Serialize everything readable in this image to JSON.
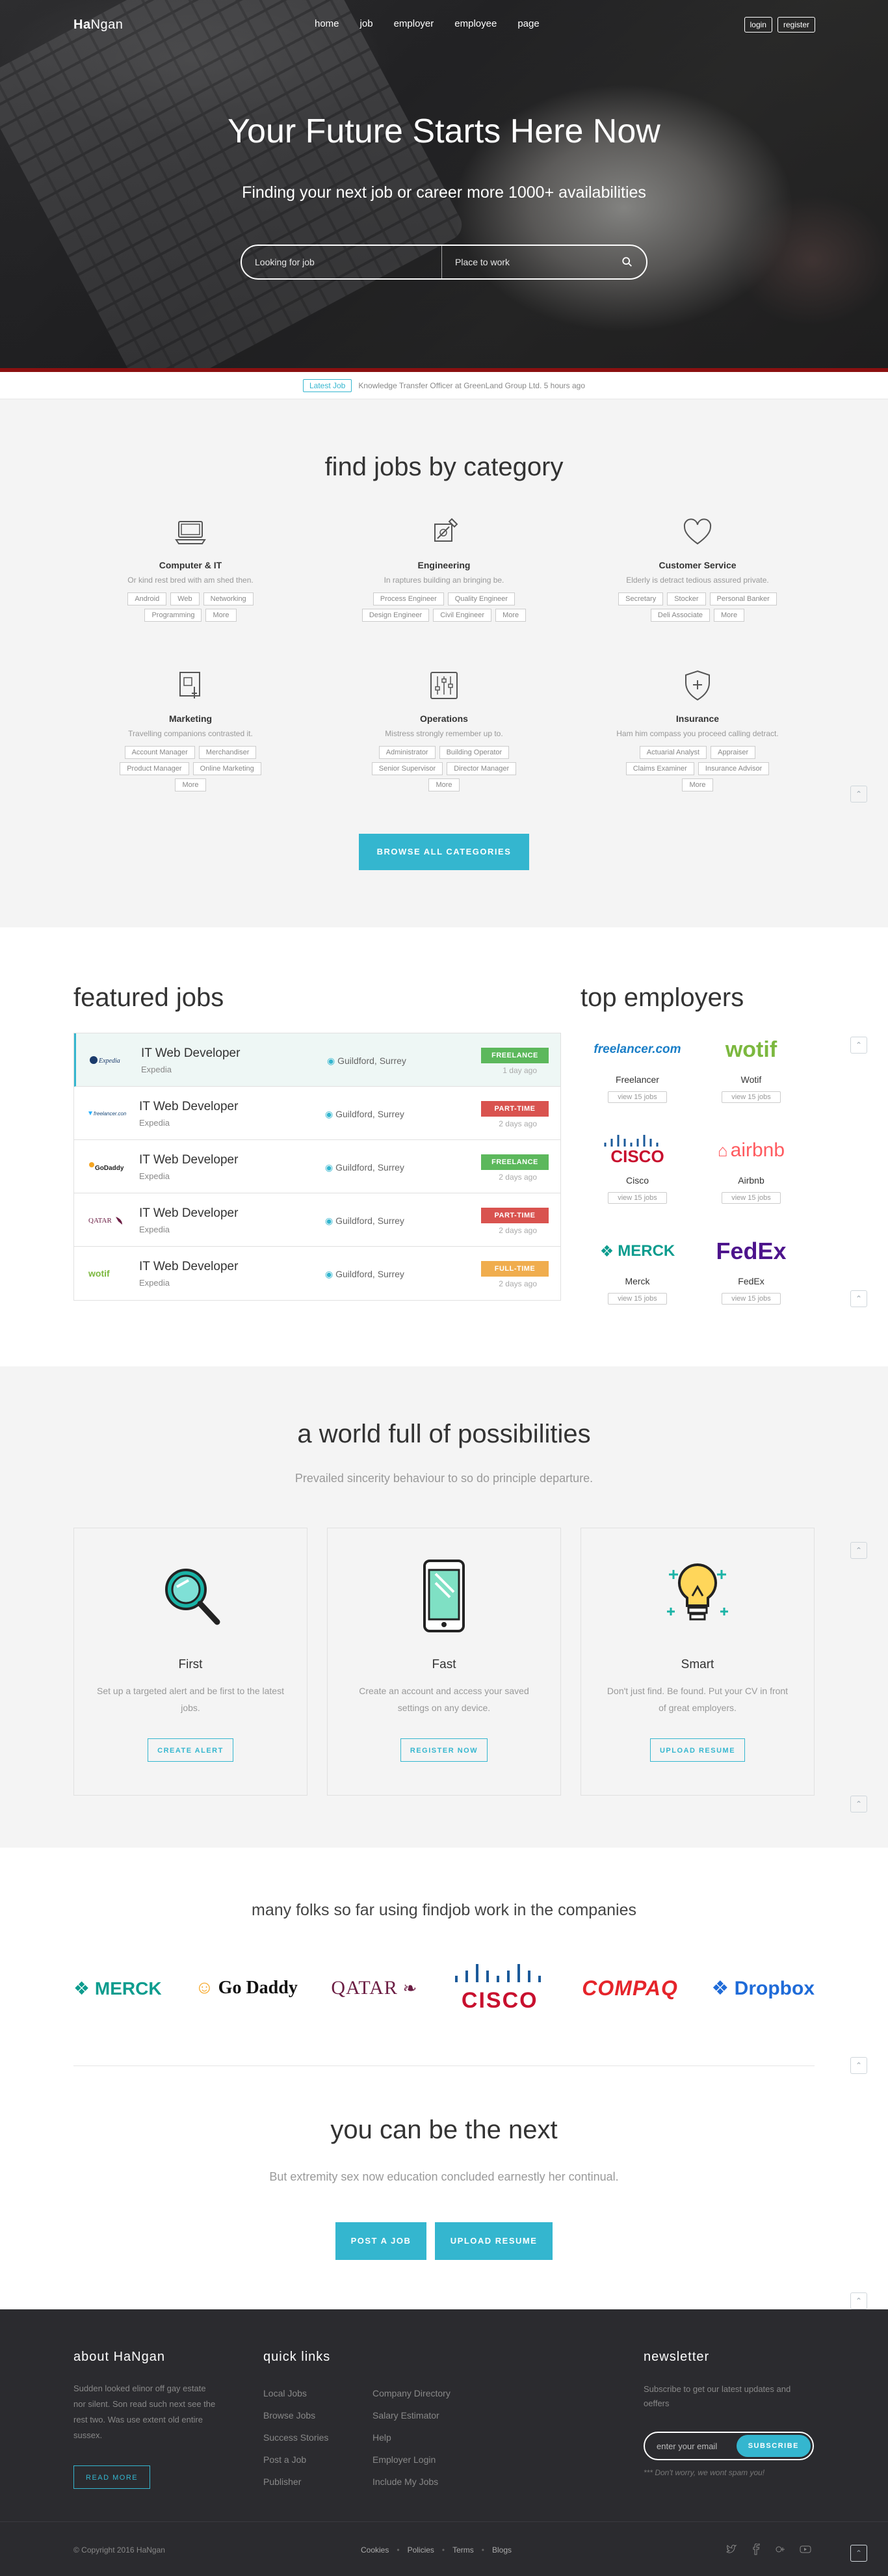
{
  "brand": {
    "logo_bold": "Ha",
    "logo_rest": "Ngan",
    "accent": "#34b6cf"
  },
  "nav": {
    "items": [
      "home",
      "job",
      "employer",
      "employee",
      "page"
    ],
    "login": "login",
    "register": "register"
  },
  "hero": {
    "title": "Your Future Starts Here Now",
    "subtitle": "Finding your next job or career more 1000+ availabilities",
    "search_job_placeholder": "Looking for job",
    "search_place_placeholder": "Place to work"
  },
  "ticker": {
    "tag": "Latest Job",
    "text": "Knowledge Transfer Officer at GreenLand Group Ltd. 5 hours ago"
  },
  "categories": {
    "title": "find jobs by category",
    "button": "BROWSE ALL CATEGORIES",
    "items": [
      {
        "icon": "computer-icon",
        "name": "Computer & IT",
        "desc": "Or kind rest bred with am shed then.",
        "tags": [
          "Android",
          "Web",
          "Networking",
          "Programming",
          "More"
        ]
      },
      {
        "icon": "engineering-icon",
        "name": "Engineering",
        "desc": "In raptures building an bringing be.",
        "tags": [
          "Process Engineer",
          "Quality Engineer",
          "Design Engineer",
          "Civil Engineer",
          "More"
        ]
      },
      {
        "icon": "heart-icon",
        "name": "Customer Service",
        "desc": "Elderly is detract tedious assured private.",
        "tags": [
          "Secretary",
          "Stocker",
          "Personal Banker",
          "Deli Associate",
          "More"
        ]
      },
      {
        "icon": "marketing-icon",
        "name": "Marketing",
        "desc": "Travelling companions contrasted it.",
        "tags": [
          "Account Manager",
          "Merchandiser",
          "Product Manager",
          "Online Marketing",
          "More"
        ]
      },
      {
        "icon": "sliders-icon",
        "name": "Operations",
        "desc": "Mistress strongly remember up to.",
        "tags": [
          "Administrator",
          "Building Operator",
          "Senior Supervisor",
          "Director Manager",
          "More"
        ]
      },
      {
        "icon": "shield-icon",
        "name": "Insurance",
        "desc": "Ham him compass you proceed calling detract.",
        "tags": [
          "Actuarial Analyst",
          "Appraiser",
          "Claims Examiner",
          "Insurance Advisor",
          "More"
        ]
      }
    ]
  },
  "featured": {
    "title": "featured jobs",
    "jobs": [
      {
        "logo": "Expedia",
        "title": "IT Web Developer",
        "company": "Expedia",
        "location": "Guildford, Surrey",
        "type": "FREELANCE",
        "type_color": "#5cb85c",
        "ago": "1 day ago"
      },
      {
        "logo": "freelancer.com",
        "title": "IT Web Developer",
        "company": "Expedia",
        "location": "Guildford, Surrey",
        "type": "PART-TIME",
        "type_color": "#d9534f",
        "ago": "2 days ago"
      },
      {
        "logo": "GoDaddy",
        "title": "IT Web Developer",
        "company": "Expedia",
        "location": "Guildford, Surrey",
        "type": "FREELANCE",
        "type_color": "#5cb85c",
        "ago": "2 days ago"
      },
      {
        "logo": "QATAR",
        "title": "IT Web Developer",
        "company": "Expedia",
        "location": "Guildford, Surrey",
        "type": "PART-TIME",
        "type_color": "#d9534f",
        "ago": "2 days ago"
      },
      {
        "logo": "wotif",
        "title": "IT Web Developer",
        "company": "Expedia",
        "location": "Guildford, Surrey",
        "type": "FULL-TIME",
        "type_color": "#f0ad4e",
        "ago": "2 days ago"
      }
    ]
  },
  "employers": {
    "title": "top employers",
    "items": [
      {
        "logo": "freelancer.com",
        "name": "Freelancer",
        "jobs": "view 15 jobs",
        "color": "#1a7ec7"
      },
      {
        "logo": "wotif",
        "name": "Wotif",
        "jobs": "view 15 jobs",
        "color": "#7cb83f"
      },
      {
        "logo": "CISCO",
        "name": "Cisco",
        "jobs": "view 15 jobs",
        "color": "#c8102e"
      },
      {
        "logo": "airbnb",
        "name": "Airbnb",
        "jobs": "view 15 jobs",
        "color": "#ff5a5f"
      },
      {
        "logo": "MERCK",
        "name": "Merck",
        "jobs": "view 15 jobs",
        "color": "#0c9c8e"
      },
      {
        "logo": "FedEx",
        "name": "FedEx",
        "jobs": "view 15 jobs",
        "color": "#4d148c"
      }
    ]
  },
  "possibilities": {
    "title": "a world full of possibilities",
    "lead": "Prevailed sincerity behaviour to so do principle departure.",
    "cards": [
      {
        "icon": "magnifier-icon",
        "title": "First",
        "text": "Set up a targeted alert and be first to the latest jobs.",
        "button": "CREATE ALERT"
      },
      {
        "icon": "smartphone-icon",
        "title": "Fast",
        "text": "Create an account and access your saved settings on any device.",
        "button": "REGISTER NOW"
      },
      {
        "icon": "lightbulb-icon",
        "title": "Smart",
        "text": "Don't just find. Be found. Put your CV in front of great employers.",
        "button": "UPLOAD RESUME"
      }
    ]
  },
  "companies": {
    "title": "many folks so far using findjob work in the companies",
    "logos": [
      "MERCK",
      "Go Daddy",
      "QATAR",
      "CISCO",
      "COMPAQ",
      "Dropbox"
    ]
  },
  "next": {
    "title": "you can be the next",
    "lead": "But extremity sex now education concluded earnestly her continual.",
    "post": "POST A JOB",
    "upload": "UPLOAD RESUME"
  },
  "footer": {
    "about_title": "about HaNgan",
    "about_text": "Sudden looked elinor off gay estate nor silent. Son read such next see the rest two. Was use extent old entire sussex.",
    "read_more": "READ MORE",
    "quick_title": "quick links",
    "col1": [
      "Local Jobs",
      "Browse Jobs",
      "Success Stories",
      "Post a Job",
      "Publisher"
    ],
    "col2": [
      "Company Directory",
      "Salary Estimator",
      "Help",
      "Employer Login",
      "Include My Jobs"
    ],
    "news_title": "newsletter",
    "news_text": "Subscribe to get our latest updates and oeffers",
    "email_placeholder": "enter your email",
    "subscribe": "SUBSCRIBE",
    "note": "*** Don't worry, we wont spam you!",
    "copyright": "© Copyright 2016 HaNgan",
    "links": [
      "Cookies",
      "Policies",
      "Terms",
      "Blogs"
    ]
  }
}
